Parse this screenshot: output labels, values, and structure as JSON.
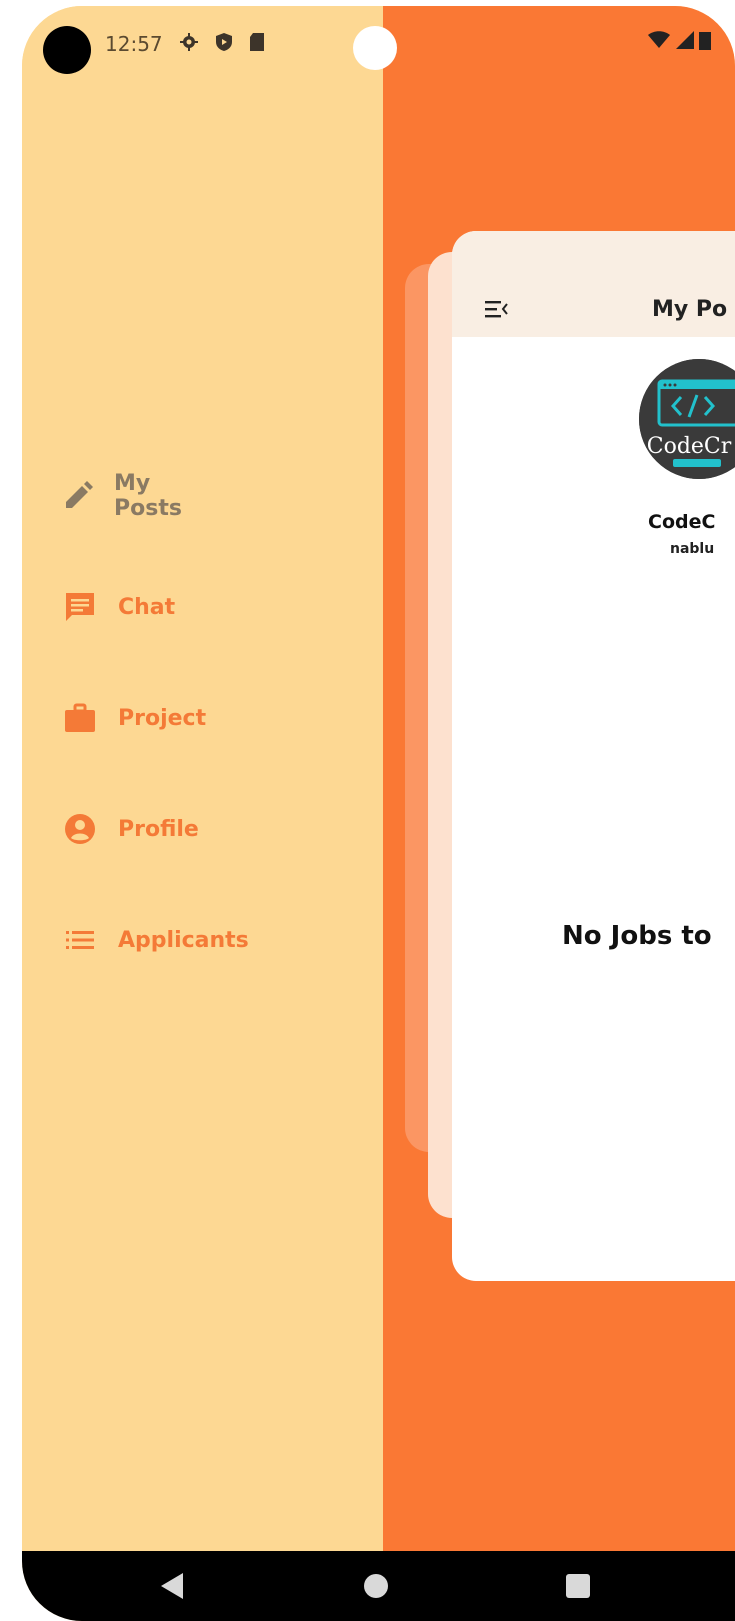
{
  "status_bar": {
    "time": "12:57",
    "left_icons": [
      "gear-icon",
      "shield-icon",
      "sd-card-icon"
    ],
    "right_icons": [
      "wifi-icon",
      "signal-icon",
      "battery-icon"
    ]
  },
  "drawer": {
    "items": [
      {
        "label": "My Posts",
        "icon": "pencil-icon",
        "selected": true
      },
      {
        "label": "Chat",
        "icon": "chat-icon",
        "selected": false
      },
      {
        "label": "Project",
        "icon": "briefcase-icon",
        "selected": false
      },
      {
        "label": "Profile",
        "icon": "account-circle-icon",
        "selected": false
      },
      {
        "label": "Applicants",
        "icon": "list-icon",
        "selected": false
      }
    ]
  },
  "main": {
    "title": "My Po",
    "org_name": "CodeC",
    "org_sub": "nablu",
    "avatar_logo_text": "CodeCr",
    "empty_message": "No Jobs to"
  },
  "colors": {
    "drawer_bg": "#fdd893",
    "accent": "#fa7834",
    "muted": "#8a7a63"
  }
}
